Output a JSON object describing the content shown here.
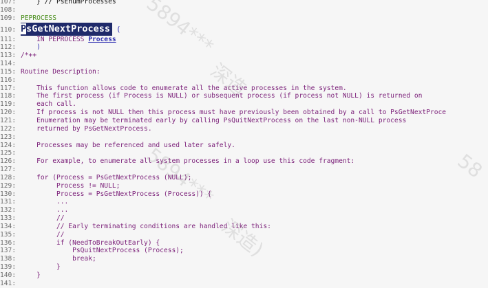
{
  "editor": {
    "line_numbers": [
      "107:",
      "108:",
      "109:",
      "110:",
      "111:",
      "112:",
      "113:",
      "114:",
      "115:",
      "116:",
      "117:",
      "118:",
      "119:",
      "120:",
      "121:",
      "122:",
      "123:",
      "124:",
      "125:",
      "126:",
      "127:",
      "128:",
      "129:",
      "130:",
      "131:",
      "132:",
      "133:",
      "134:",
      "135:",
      "136:",
      "137:",
      "138:",
      "139:",
      "140:",
      "141:"
    ],
    "lines": {
      "l107": "    } // PsEnumProcesses",
      "l108": "",
      "l109": "PEPROCESS",
      "l110_first": "P",
      "l110_rest": "sGetNextProcess",
      "l110_paren": "(",
      "l111_kw": "    IN PEPROCESS ",
      "l111_name": "Process",
      "l112": "    )",
      "l113": "/*++",
      "l114": "",
      "l115": "Routine Description:",
      "l116": "",
      "l117": "    This function allows code to enumerate all the active processes in the system.",
      "l118": "    The first process (if Process is NULL) or subsequent process (if process not NULL) is returned on",
      "l119": "    each call.",
      "l120": "    If process is not NULL then this process must have previously been obtained by a call to PsGetNextProce",
      "l121": "    Enumeration may be terminated early by calling PsQuitNextProcess on the last non-NULL process",
      "l122": "    returned by PsGetNextProcess.",
      "l123": "",
      "l124": "    Processes may be referenced and used later safely.",
      "l125": "",
      "l126": "    For example, to enumerate all system processes in a loop use this code fragment:",
      "l127": "",
      "l128": "    for (Process = PsGetNextProcess (NULL);",
      "l129": "         Process != NULL;",
      "l130": "         Process = PsGetNextProcess (Process)) {",
      "l131": "         ...",
      "l132": "         ...",
      "l133": "         //",
      "l134": "         // Early terminating conditions are handled like this:",
      "l135": "         //",
      "l136": "         if (NeedToBreakOutEarly) {",
      "l137": "             PsQuitNextProcess (Process);",
      "l138": "             break;",
      "l139": "         }",
      "l140": "    }",
      "l141": ""
    }
  },
  "watermark": {
    "text1": "5894***",
    "text2": "深造",
    "text3": "5894***",
    "text4": "深造)",
    "text5": "58"
  },
  "colors": {
    "background": "#f6f6f6",
    "comment_text": "#7a1e78",
    "type_green": "#4b8f1e",
    "selection": "#1f2a6a"
  }
}
